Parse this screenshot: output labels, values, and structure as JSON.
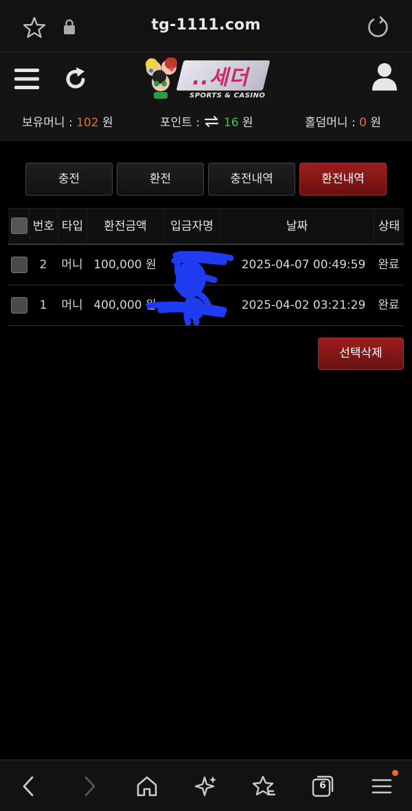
{
  "browser": {
    "url": "tg-1111.com",
    "tab_count": "6",
    "icons": [
      "star-icon",
      "lock-icon",
      "reload-icon",
      "back-icon",
      "forward-icon",
      "home-icon",
      "sparkle-icon",
      "bookmark-star-icon",
      "tabs-icon",
      "menu-icon"
    ]
  },
  "header": {
    "logo_text": "..세더",
    "logo_sub": "SPORTS & CASINO"
  },
  "balances": {
    "money_label": "보유머니 :",
    "money_value": "102",
    "point_label": "포인트 :",
    "point_value": "16",
    "holdem_label": "홀덤머니 :",
    "holdem_value": "0",
    "unit": "원"
  },
  "tabs": [
    {
      "label": "충전",
      "active": false
    },
    {
      "label": "환전",
      "active": false
    },
    {
      "label": "충전내역",
      "active": false
    },
    {
      "label": "환전내역",
      "active": true
    }
  ],
  "table": {
    "columns": [
      "번호",
      "타입",
      "환전금액",
      "입금자명",
      "날짜",
      "상태"
    ],
    "rows": [
      {
        "no": "2",
        "type": "머니",
        "amount": "100,000 원",
        "depositor": "",
        "date": "2025-04-07 00:49:59",
        "status": "완료"
      },
      {
        "no": "1",
        "type": "머니",
        "amount": "400,000 원",
        "depositor": "",
        "date": "2025-04-02 03:21:29",
        "status": "완료"
      }
    ]
  },
  "actions": {
    "delete_selected": "선택삭제"
  },
  "colors": {
    "accent_red": "#8a1818",
    "orange_value": "#e0703c",
    "green_value": "#4bc14b",
    "notif_dot": "#f06b2a"
  }
}
